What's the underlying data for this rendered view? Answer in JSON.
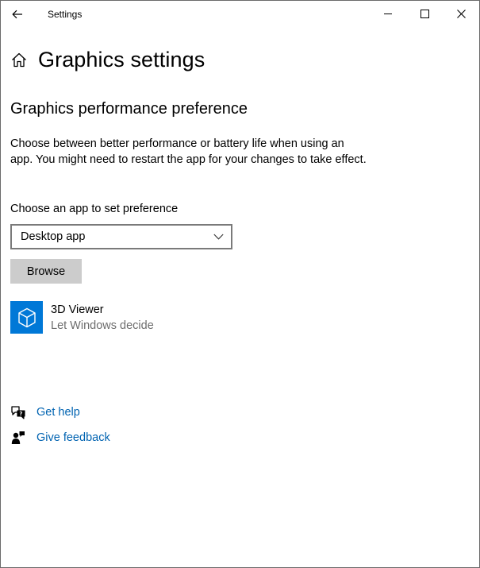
{
  "window": {
    "title": "Settings"
  },
  "header": {
    "title": "Graphics settings"
  },
  "section": {
    "title": "Graphics performance preference",
    "description": "Choose between better performance or battery life when using an app. You might need to restart the app for your changes to take effect."
  },
  "app_picker": {
    "label": "Choose an app to set preference",
    "selected": "Desktop app",
    "browse_label": "Browse"
  },
  "apps": [
    {
      "name": "3D Viewer",
      "preference": "Let Windows decide",
      "tile_color": "#0078d7"
    }
  ],
  "links": {
    "help": "Get help",
    "feedback": "Give feedback"
  },
  "colors": {
    "accent": "#0078d7",
    "link": "#0063b1",
    "button_bg": "#cccccc",
    "secondary_text": "#6d6d6d"
  },
  "icons": {
    "back": "back-arrow-icon",
    "home": "home-icon",
    "minimize": "minimize-icon",
    "maximize": "maximize-icon",
    "close": "close-icon",
    "chevron": "chevron-down-icon",
    "app": "cube-icon",
    "help": "chat-help-icon",
    "feedback": "feedback-person-icon"
  }
}
